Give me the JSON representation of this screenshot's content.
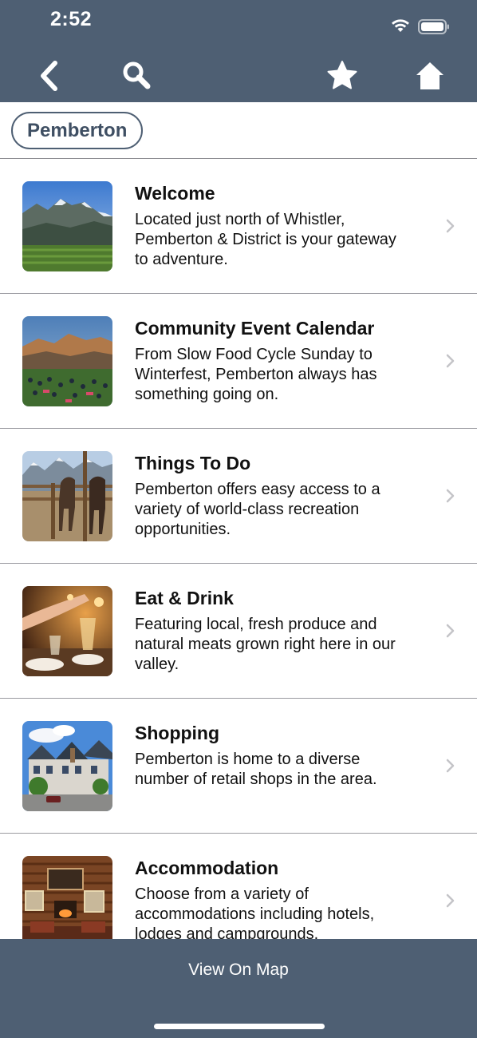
{
  "status_bar": {
    "time": "2:52",
    "wifi_icon": "wifi-icon",
    "battery_icon": "battery-icon"
  },
  "navbar": {
    "back_icon": "chevron-left-icon",
    "search_icon": "search-icon",
    "favorite_icon": "star-icon",
    "home_icon": "home-icon"
  },
  "filter": {
    "chip_label": "Pemberton"
  },
  "items": [
    {
      "title": "Welcome",
      "description": "Located just north of Whistler, Pemberton & District is your gateway to adventure.",
      "image": "mountain-valley"
    },
    {
      "title": "Community Event Calendar",
      "description": "From Slow Food Cycle Sunday to Winterfest, Pemberton always has something going on.",
      "image": "crowd-festival"
    },
    {
      "title": "Things To Do",
      "description": "Pemberton offers easy access to a variety of world-class recreation opportunities.",
      "image": "horses-mountains"
    },
    {
      "title": "Eat & Drink",
      "description": "Featuring local, fresh produce and natural meats grown right here in our valley.",
      "image": "dinner-table"
    },
    {
      "title": "Shopping",
      "description": "Pemberton is home to a diverse number of retail shops in the area.",
      "image": "main-street"
    },
    {
      "title": "Accommodation",
      "description": "Choose from a variety of accommodations including hotels, lodges and campgrounds.",
      "image": "log-lodge-interior"
    }
  ],
  "bottom": {
    "map_button_label": "View On Map"
  },
  "colors": {
    "bar": "#4e5f73",
    "chip_border": "#4e5f73",
    "divider": "#9a9aa0"
  }
}
